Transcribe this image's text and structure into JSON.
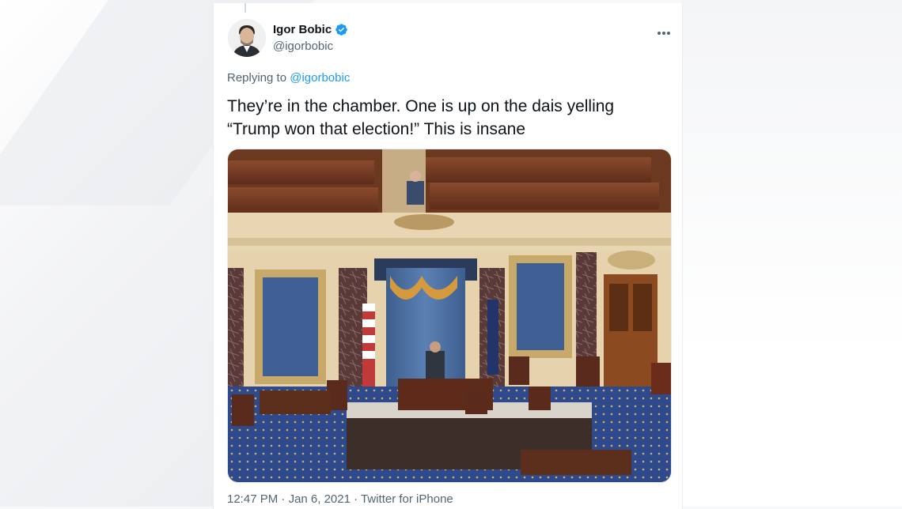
{
  "tweet": {
    "author_name": "Igor Bobic",
    "author_handle": "@igorbobic",
    "verified": true,
    "replying_prefix": "Replying to",
    "replying_to": "@igorbobic",
    "text_line1": "They’re in the chamber. One is up on the dais yelling",
    "text_line2": "“Trump won that election!” This is insane",
    "time": "12:47 PM",
    "date": "Jan 6, 2021",
    "source": "Twitter for iPhone",
    "separator": "·"
  },
  "icons": {
    "more": "more-dots-icon",
    "verified": "verified-badge-icon"
  },
  "colors": {
    "accent": "#1d9bf0",
    "text_primary": "#0f1419",
    "text_secondary": "#536471"
  }
}
